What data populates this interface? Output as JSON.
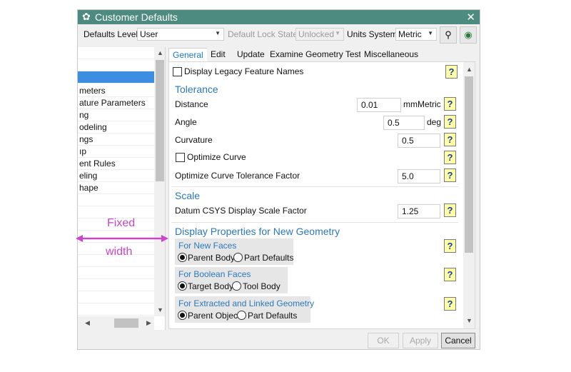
{
  "window": {
    "title": "Customer Defaults",
    "close": "✕"
  },
  "toolbar": {
    "defaults_level_label": "Defaults Level",
    "defaults_level_value": "User",
    "lock_state_label": "Default Lock State",
    "lock_state_value": "Unlocked",
    "units_label": "Units System",
    "units_value": "Metric"
  },
  "sidebar": {
    "items": [
      {
        "label": ""
      },
      {
        "label": ""
      },
      {
        "label": "",
        "selected": true
      },
      {
        "label": "meters"
      },
      {
        "label": "ature Parameters"
      },
      {
        "label": "ng"
      },
      {
        "label": "odeling"
      },
      {
        "label": "ngs"
      },
      {
        "label": "ıp"
      },
      {
        "label": "ent Rules"
      },
      {
        "label": "eling"
      },
      {
        "label": "hape"
      }
    ]
  },
  "tabs": [
    "General",
    "Edit",
    "Update",
    "Examine Geometry Tests",
    "Miscellaneous"
  ],
  "content": {
    "display_legacy": "Display Legacy Feature Names",
    "tolerance": {
      "title": "Tolerance",
      "distance_label": "Distance",
      "distance_value": "0.01",
      "distance_unit": "mmMetric",
      "angle_label": "Angle",
      "angle_value": "0.5",
      "angle_unit": "deg",
      "curvature_label": "Curvature",
      "curvature_value": "0.5",
      "optimize_curve": "Optimize Curve",
      "optimize_factor_label": "Optimize Curve Tolerance Factor",
      "optimize_factor_value": "5.0"
    },
    "scale": {
      "title": "Scale",
      "datum_label": "Datum CSYS Display Scale Factor",
      "datum_value": "1.25"
    },
    "display_props": {
      "title": "Display Properties for New Geometry",
      "new_faces": {
        "title": "For New Faces",
        "opt1": "Parent Body",
        "opt2": "Part Defaults"
      },
      "boolean_faces": {
        "title": "For Boolean Faces",
        "opt1": "Target Body",
        "opt2": "Tool Body"
      },
      "extracted": {
        "title": "For Extracted and Linked Geometry",
        "opt1": "Parent Object",
        "opt2": "Part Defaults"
      }
    },
    "help": "?"
  },
  "buttons": {
    "ok": "OK",
    "apply": "Apply",
    "cancel": "Cancel"
  },
  "annotation": {
    "line1": "Fixed",
    "line2": "width"
  },
  "colors": {
    "titlebar": "#4d8a80",
    "accent": "#2a78bd",
    "selection": "#3d8ee0",
    "annotation": "#cc44cc"
  }
}
